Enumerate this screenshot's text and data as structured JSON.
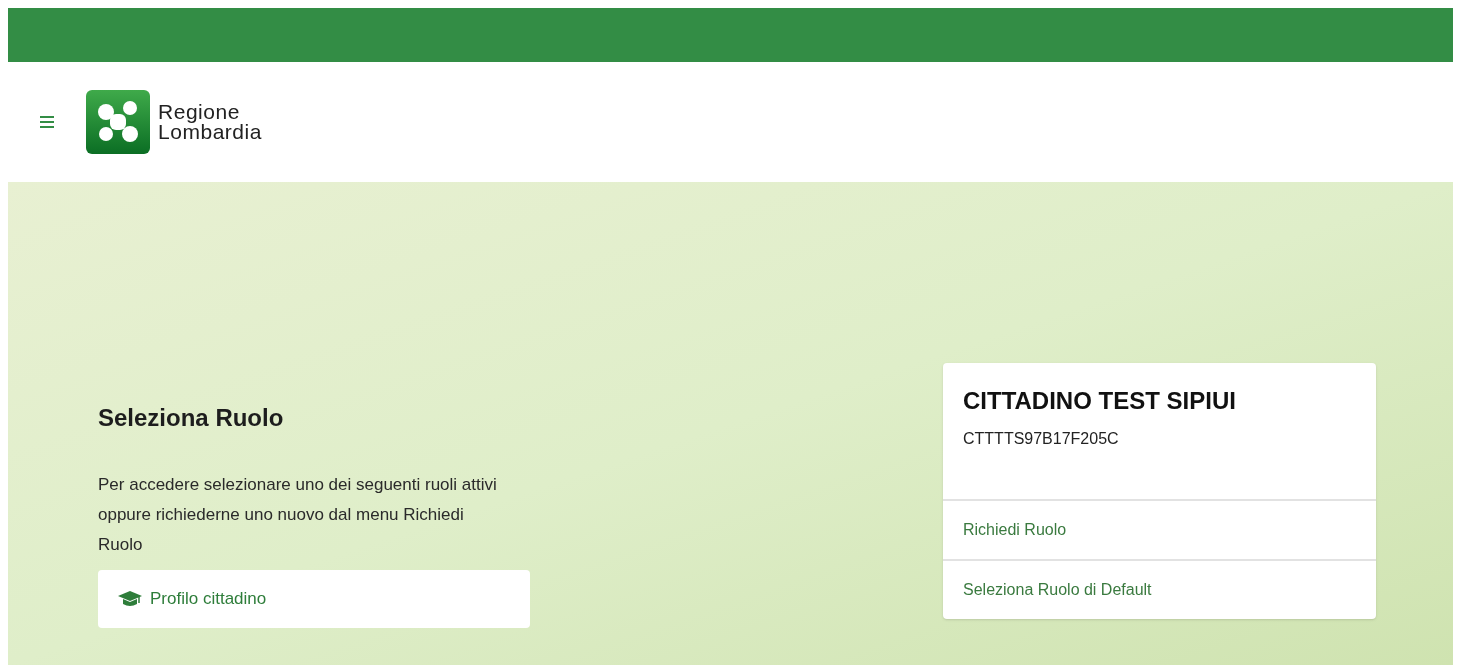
{
  "header": {
    "logo": {
      "line_1": "Regione",
      "line_2": "Lombardia"
    }
  },
  "role_selection": {
    "title": "Seleziona Ruolo",
    "description": "Per accedere selezionare uno dei seguenti ruoli attivi oppure richiederne uno nuovo dal menu Richiedi Ruolo",
    "roles": [
      {
        "label": "Profilo cittadino"
      }
    ]
  },
  "user_card": {
    "name": "CITTADINO TEST SIPIUI",
    "fiscal_code": "CTTTTS97B17F205C",
    "links": [
      "Richiedi Ruolo",
      "Seleziona Ruolo di Default"
    ]
  }
}
